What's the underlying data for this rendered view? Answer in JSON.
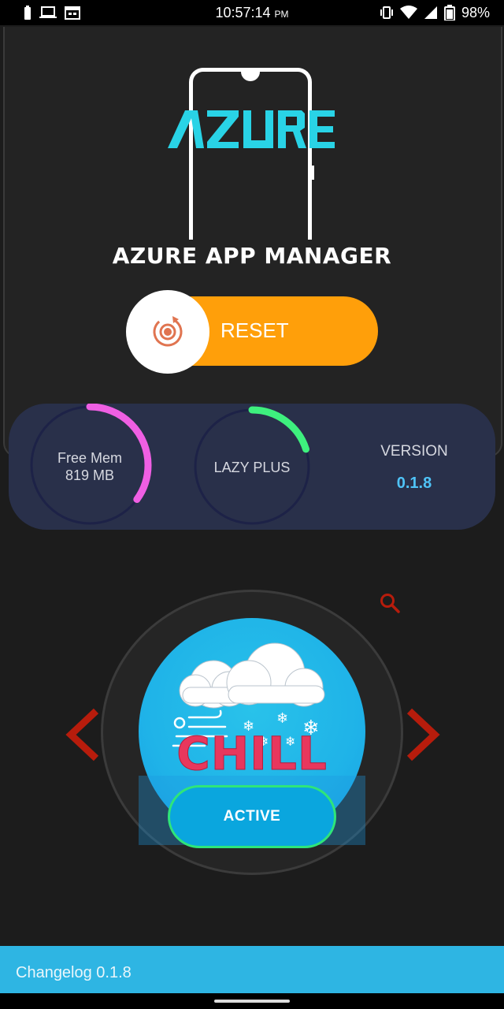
{
  "status_bar": {
    "time": "10:57:14",
    "time_suffix": "PM",
    "battery_percent": "98%",
    "left_icons": [
      "battery-saver-icon",
      "laptop-icon",
      "calendar-icon"
    ],
    "right_icons": [
      "vibrate-icon",
      "wifi-icon",
      "signal-icon",
      "battery-icon"
    ]
  },
  "header": {
    "logo_text": "AZURE",
    "logo_color": "#29d3e6",
    "title": "AZURE APP MANAGER"
  },
  "reset": {
    "label": "RESET",
    "pill_color": "#ff9f0a",
    "icon": "reset-icon"
  },
  "stats": {
    "free_mem": {
      "label": "Free Mem",
      "value": "819 MB",
      "arc_color": "#ef5fe3",
      "level": 0.35
    },
    "profile": {
      "label": "LAZY PLUS",
      "arc_color": "#3ef07e",
      "level": 0.2
    },
    "version": {
      "label": "VERSION",
      "value": "0.1.8",
      "value_color": "#4fc3f7"
    }
  },
  "profile_selector": {
    "current": "CHILL",
    "status_button": "ACTIVE",
    "search_icon": "search-icon",
    "prev_icon": "chevron-left-icon",
    "next_icon": "chevron-right-icon",
    "arrow_color": "#b71c0c"
  },
  "changelog": {
    "label": "Changelog 0.1.8"
  }
}
